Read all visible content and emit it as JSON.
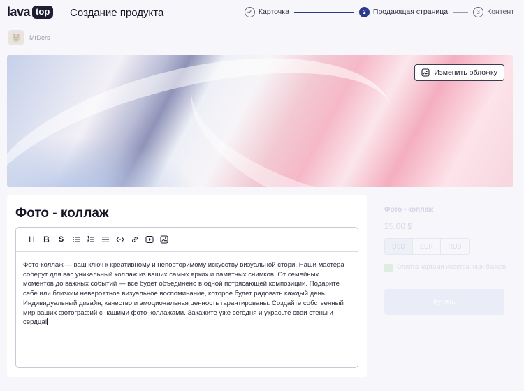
{
  "header": {
    "logo_text": "lava",
    "logo_badge": "top",
    "page_title": "Создание продукта",
    "steps": [
      {
        "number": "1",
        "label": "Карточка",
        "state": "done"
      },
      {
        "number": "2",
        "label": "Продающая страница",
        "state": "active"
      },
      {
        "number": "3",
        "label": "Контент",
        "state": "pending"
      }
    ]
  },
  "author": {
    "name": "MrDers"
  },
  "cover": {
    "change_button": "Изменить обложку"
  },
  "product": {
    "title": "Фото - коллаж",
    "toolbar": [
      "heading-icon",
      "bold-icon",
      "strikethrough-icon",
      "bullet-list-icon",
      "numbered-list-icon",
      "divider-icon",
      "code-icon",
      "link-icon",
      "video-icon",
      "image-icon"
    ],
    "description": "Фото-коллаж — ваш ключ к креативному и неповторимому искусству визуальной стори. Наши мастера соберут для вас уникальный коллаж из ваших самых ярких и памятных снимков. От семейных моментов до важных событий — все будет объединено в одной потрясающей композиции. Подарите себе или близким невероятное визуальное воспоминание, которое будет радовать каждый день. Индивидуальный дизайн, качество и эмоциональная ценность гарантированы. Создайте собственный мир ваших фотографий с нашими фото-коллажами. Закажите уже сегодня и украсьте свои стены и сердца!"
  },
  "preview": {
    "name": "Фото - коллаж",
    "price": "25,00 $",
    "currencies": [
      "USD",
      "EUR",
      "RUB"
    ],
    "selected_currency": "USD",
    "card_note": "Оплата картами иностранных банков",
    "buy_button": "Купить"
  },
  "colors": {
    "accent": "#2c3a8c",
    "dark": "#1d1d35"
  }
}
